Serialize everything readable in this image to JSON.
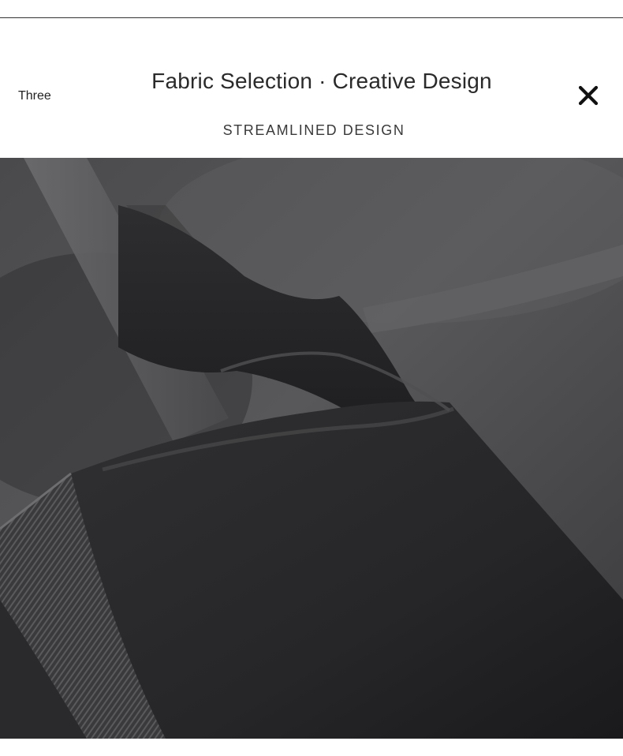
{
  "header": {
    "section_label": "Three",
    "title": "Fabric Selection · Creative Design",
    "subtitle": "STREAMLINED DESIGN"
  },
  "close_button": {
    "icon": "close-icon"
  },
  "photo": {
    "subject": "fabric-photo",
    "colors": {
      "base": "#3d3d3f",
      "dark": "#1f1f21",
      "light": "#5a5a5c"
    }
  }
}
